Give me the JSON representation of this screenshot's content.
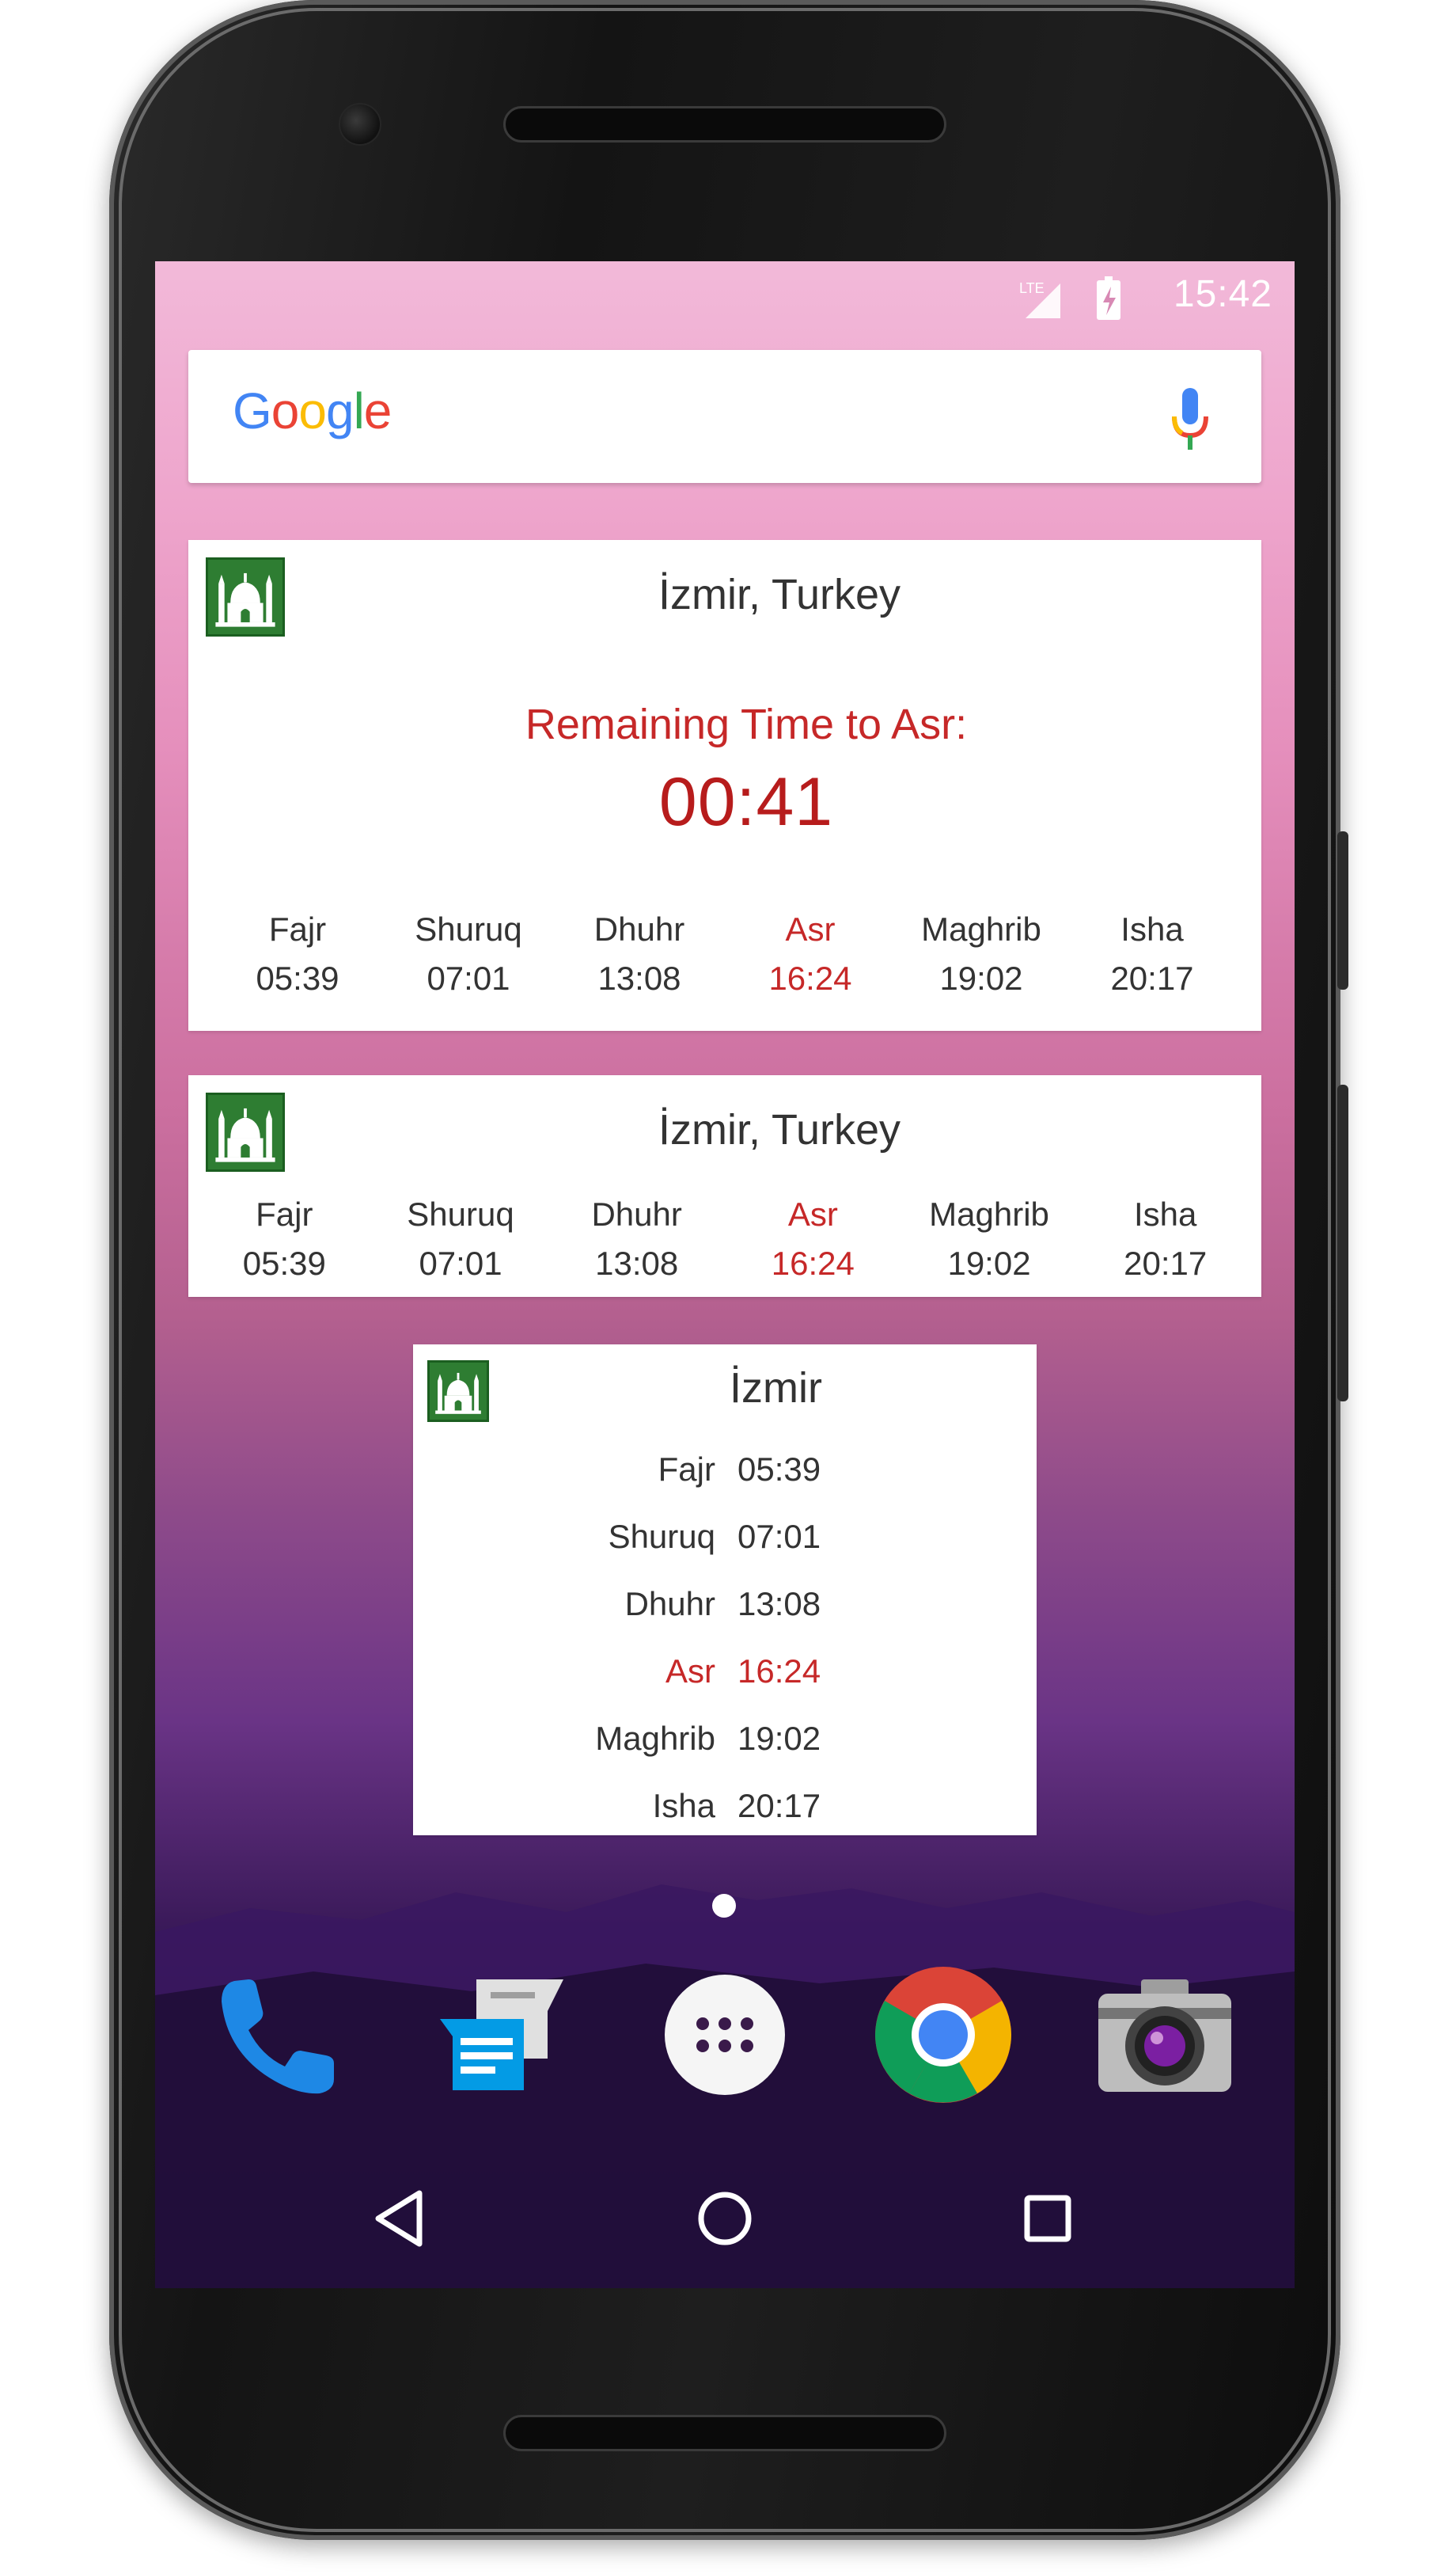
{
  "status_bar": {
    "network": "LTE",
    "time": "15:42"
  },
  "search": {
    "logo": "Google",
    "mic_icon": "mic-icon"
  },
  "colors": {
    "active": "#c62828",
    "app_icon": "#2e7d32",
    "text": "#333333"
  },
  "widget_large": {
    "city": "İzmir, Turkey",
    "remaining_label": "Remaining Time to Asr:",
    "remaining_time": "00:41",
    "prayers": [
      {
        "name": "Fajr",
        "time": "05:39",
        "active": false
      },
      {
        "name": "Shuruq",
        "time": "07:01",
        "active": false
      },
      {
        "name": "Dhuhr",
        "time": "13:08",
        "active": false
      },
      {
        "name": "Asr",
        "time": "16:24",
        "active": true
      },
      {
        "name": "Maghrib",
        "time": "19:02",
        "active": false
      },
      {
        "name": "Isha",
        "time": "20:17",
        "active": false
      }
    ]
  },
  "widget_medium": {
    "city": "İzmir, Turkey",
    "prayers": [
      {
        "name": "Fajr",
        "time": "05:39",
        "active": false
      },
      {
        "name": "Shuruq",
        "time": "07:01",
        "active": false
      },
      {
        "name": "Dhuhr",
        "time": "13:08",
        "active": false
      },
      {
        "name": "Asr",
        "time": "16:24",
        "active": true
      },
      {
        "name": "Maghrib",
        "time": "19:02",
        "active": false
      },
      {
        "name": "Isha",
        "time": "20:17",
        "active": false
      }
    ]
  },
  "widget_small": {
    "city": "İzmir",
    "prayers": [
      {
        "name": "Fajr",
        "time": "05:39",
        "active": false
      },
      {
        "name": "Shuruq",
        "time": "07:01",
        "active": false
      },
      {
        "name": "Dhuhr",
        "time": "13:08",
        "active": false
      },
      {
        "name": "Asr",
        "time": "16:24",
        "active": true
      },
      {
        "name": "Maghrib",
        "time": "19:02",
        "active": false
      },
      {
        "name": "Isha",
        "time": "20:17",
        "active": false
      }
    ]
  },
  "dock": [
    {
      "app": "Phone",
      "icon": "phone-icon"
    },
    {
      "app": "Messages",
      "icon": "messages-icon"
    },
    {
      "app": "Apps",
      "icon": "app-drawer-icon"
    },
    {
      "app": "Chrome",
      "icon": "chrome-icon"
    },
    {
      "app": "Camera",
      "icon": "camera-icon"
    }
  ],
  "nav": {
    "back": "back-icon",
    "home": "home-icon",
    "recents": "recents-icon"
  }
}
